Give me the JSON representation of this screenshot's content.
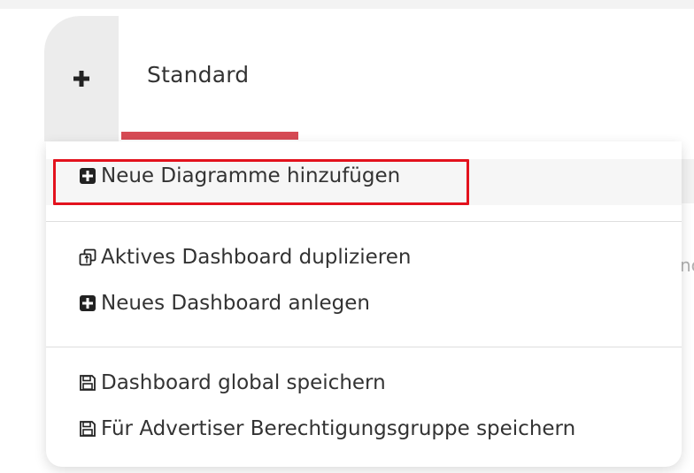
{
  "tabs": {
    "add_icon": "plus-icon",
    "active_tab_label": "Standard",
    "accent_color": "#d64a54"
  },
  "menu": {
    "group1": [
      {
        "label": "Neue Diagramme hinzufügen",
        "icon": "plus-square-icon",
        "highlighted": true
      }
    ],
    "group2": [
      {
        "label": "Aktives Dashboard duplizieren",
        "icon": "copy-icon"
      },
      {
        "label": "Neues Dashboard anlegen",
        "icon": "plus-square-icon"
      }
    ],
    "group3": [
      {
        "label": "Dashboard global speichern",
        "icon": "save-icon"
      },
      {
        "label": "Für Advertiser Berechtigungsgruppe speichern",
        "icon": "save-icon"
      }
    ],
    "highlight_color": "#e3121d"
  },
  "background": {
    "peek_text": "nc"
  }
}
